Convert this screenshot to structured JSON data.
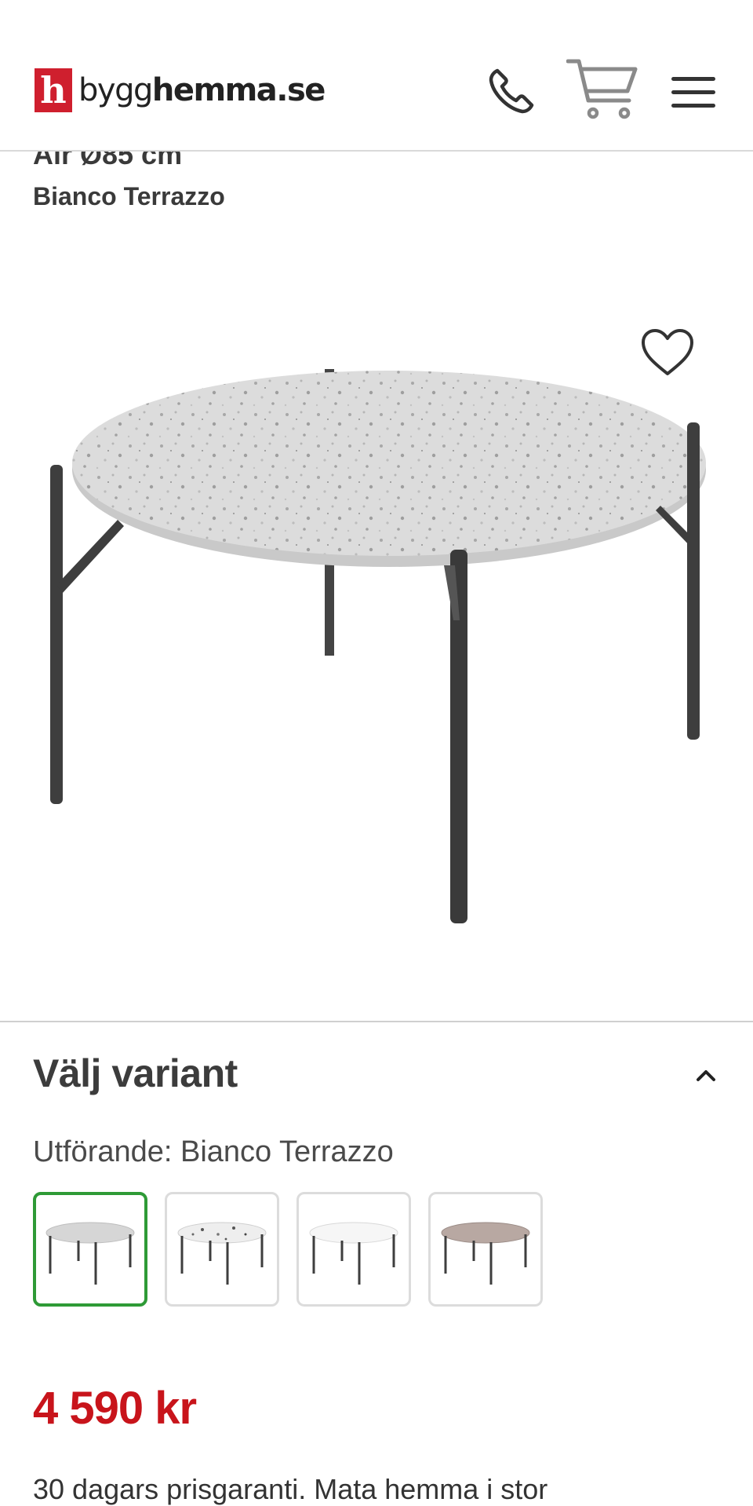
{
  "header": {
    "logo_letter": "h",
    "logo_text_light": "bygg",
    "logo_text_bold": "hemma.se",
    "icons": [
      "phone-icon",
      "cart-icon",
      "menu-icon"
    ]
  },
  "product": {
    "title_partial": "Air Ø85 cm",
    "variant_name": "Bianco Terrazzo"
  },
  "variant_section": {
    "heading": "Välj variant",
    "label": "Utförande: Bianco Terrazzo",
    "swatches": [
      {
        "selected": true
      },
      {
        "selected": false
      },
      {
        "selected": false
      },
      {
        "selected": false
      }
    ]
  },
  "price": "4 590 kr",
  "bottom_text": "30 dagars prisgaranti. Mata hemma i stor"
}
